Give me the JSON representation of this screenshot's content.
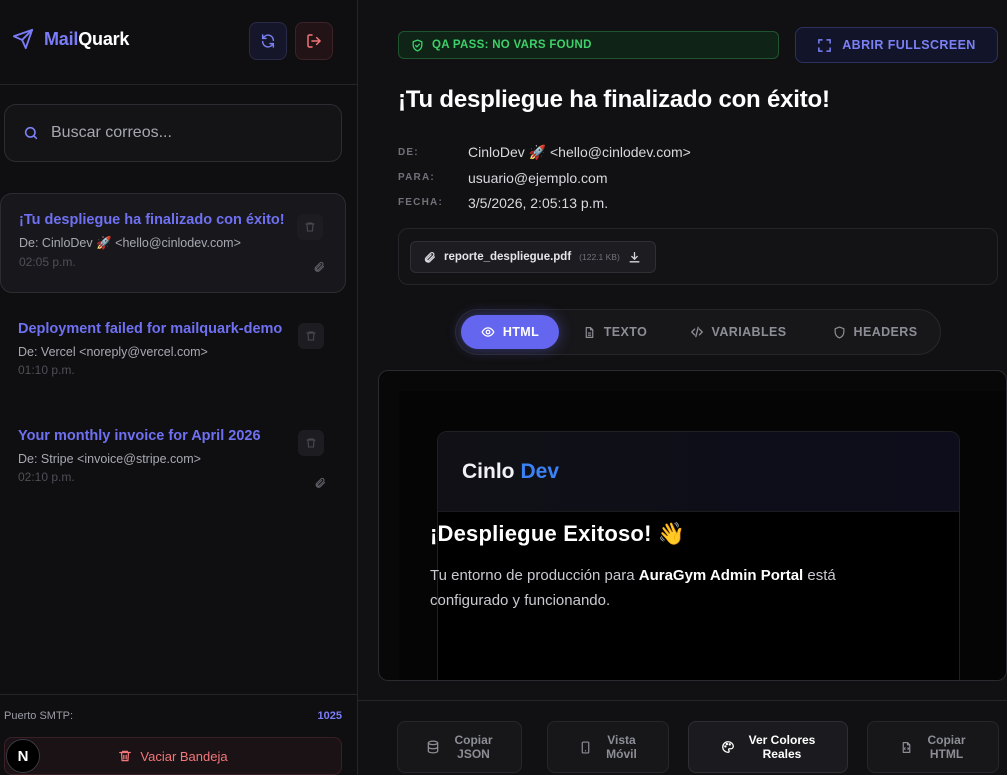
{
  "brand": {
    "part1": "Mail",
    "part2": "Quark"
  },
  "search": {
    "placeholder": "Buscar correos..."
  },
  "mails": [
    {
      "subject": "¡Tu despliegue ha finalizado con éxito!",
      "from": "De: CinloDev 🚀 <hello@cinlodev.com>",
      "time": "02:05 p.m.",
      "attachment": true
    },
    {
      "subject": "Deployment failed for mailquark-demo",
      "from": "De: Vercel <noreply@vercel.com>",
      "time": "01:10 p.m.",
      "attachment": false
    },
    {
      "subject": "Your monthly invoice for April 2026",
      "from": "De: Stripe <invoice@stripe.com>",
      "time": "02:10 p.m.",
      "attachment": true
    }
  ],
  "smtp": {
    "label": "Puerto SMTP:",
    "value": "1025"
  },
  "empty_inbox": "Vaciar Bandeja",
  "avatar_letter": "N",
  "qa_badge": "QA PASS: NO VARS FOUND",
  "fullscreen_label": "ABRIR FULLSCREEN",
  "message": {
    "title": "¡Tu despliegue ha finalizado con éxito!",
    "from_label": "DE:",
    "from_value": "CinloDev 🚀 <hello@cinlodev.com>",
    "to_label": "PARA:",
    "to_value": "usuario@ejemplo.com",
    "date_label": "FECHA:",
    "date_value": "3/5/2026, 2:05:13 p.m."
  },
  "attachment": {
    "name": "reporte_despliegue.pdf",
    "size": "(122.1 KB)"
  },
  "tabs": [
    {
      "label": "HTML",
      "active": true
    },
    {
      "label": "TEXTO",
      "active": false
    },
    {
      "label": "VARIABLES",
      "active": false
    },
    {
      "label": "HEADERS",
      "active": false
    }
  ],
  "preview": {
    "brand_a": "Cinlo",
    "brand_b": "Dev",
    "heading": "¡Despliegue Exitoso! 👋",
    "para_pre": "Tu entorno de producción para ",
    "para_bold": "AuraGym Admin Portal",
    "para_post": " está configurado y funcionando."
  },
  "actions": [
    {
      "line1": "Copiar",
      "line2": "JSON"
    },
    {
      "line1": "Vista",
      "line2": "Móvil"
    },
    {
      "line1": "Ver Colores",
      "line2": "Reales"
    },
    {
      "line1": "Copiar",
      "line2": "HTML"
    }
  ],
  "colors": {
    "accent": "#6466f0",
    "success": "#3ed06a",
    "danger": "#f2777a",
    "link_blue": "#3b82f6"
  }
}
